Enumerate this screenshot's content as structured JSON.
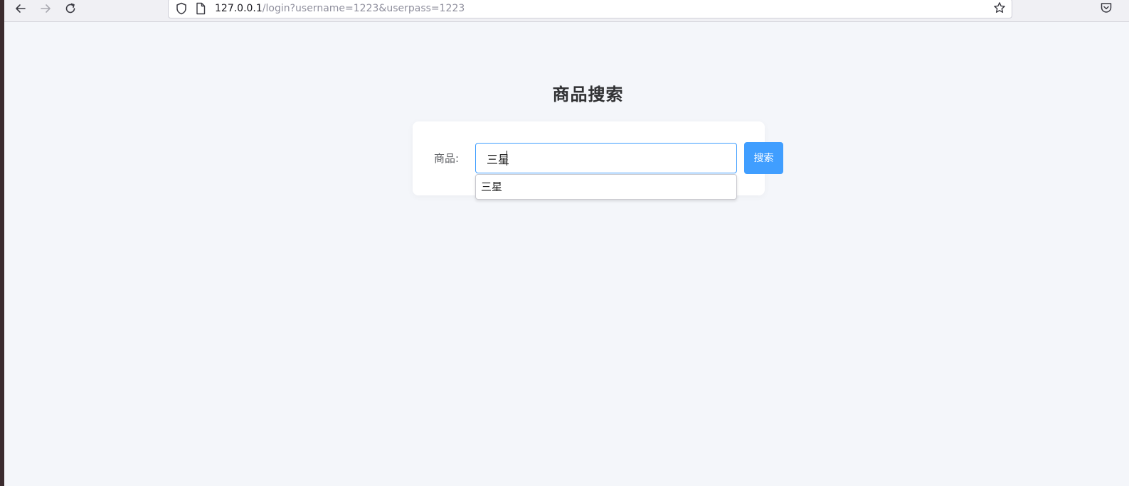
{
  "browser": {
    "url_host": "127.0.0.1",
    "url_path": "/login?username=1223&userpass=1223",
    "icons": {
      "back": "arrow-left-icon",
      "forward": "arrow-right-icon",
      "reload": "reload-icon",
      "shield": "shield-icon",
      "page": "page-icon",
      "bookmark": "star-icon",
      "pocket": "pocket-icon"
    }
  },
  "page": {
    "title": "商品搜索"
  },
  "search": {
    "label": "商品:",
    "value": "三星",
    "button_label": "搜索",
    "suggestions": [
      "三星"
    ]
  },
  "colors": {
    "primary": "#409eff",
    "background": "#f4f6fa",
    "card": "#ffffff",
    "title": "#303133",
    "label": "#606266"
  }
}
